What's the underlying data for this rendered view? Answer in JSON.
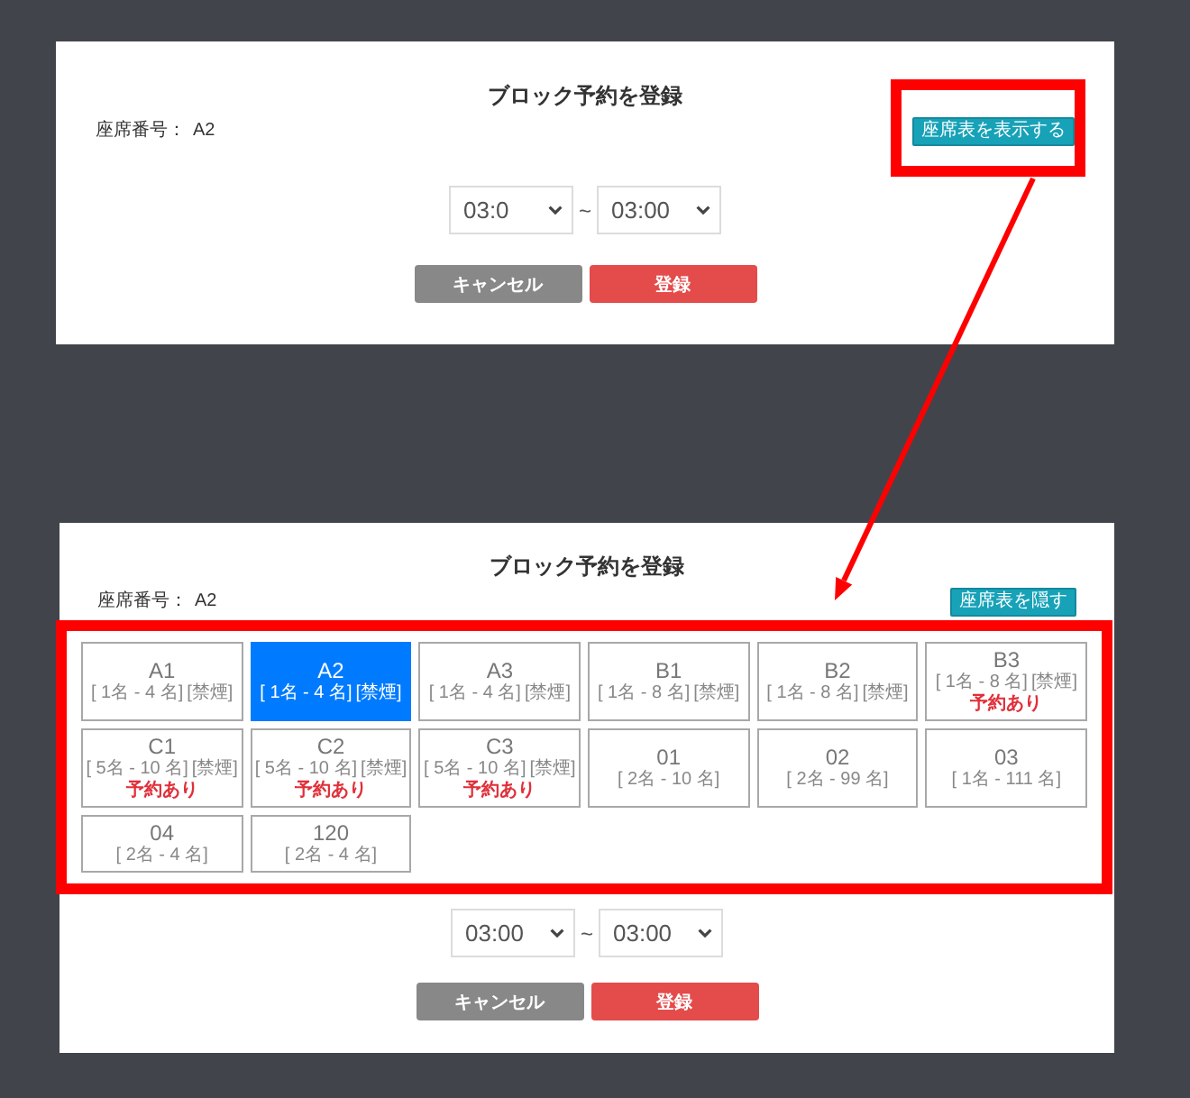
{
  "panels": [
    {
      "title": "ブロック予約を登録",
      "seat_label": "座席番号：",
      "seat_value": "A2",
      "toggle_button": {
        "label": "座席表を表示する",
        "highlighted": true
      },
      "time_from": "03:0",
      "time_separator": "~",
      "time_to": "03:00",
      "buttons": [
        {
          "label": "キャンセル",
          "kind": "cancel"
        },
        {
          "label": "登録",
          "kind": "submit"
        }
      ]
    },
    {
      "title": "ブロック予約を登録",
      "seat_label": "座席番号：",
      "seat_value": "A2",
      "toggle_button": {
        "label": "座席表を隠す"
      },
      "seat_map": {
        "highlighted": true,
        "seats": [
          {
            "name": "A1",
            "capacity": "[ 1名 - 4 名]",
            "smoking": "[禁煙]",
            "selected": false
          },
          {
            "name": "A2",
            "capacity": "[ 1名 - 4 名]",
            "smoking": "[禁煙]",
            "selected": true
          },
          {
            "name": "A3",
            "capacity": "[ 1名 - 4 名]",
            "smoking": "[禁煙]",
            "selected": false
          },
          {
            "name": "B1",
            "capacity": "[ 1名 - 8 名]",
            "smoking": "[禁煙]",
            "selected": false
          },
          {
            "name": "B2",
            "capacity": "[ 1名 - 8 名]",
            "smoking": "[禁煙]",
            "selected": false
          },
          {
            "name": "B3",
            "capacity": "[ 1名 - 8 名]",
            "smoking": "[禁煙]",
            "status": "予約あり",
            "selected": false
          },
          {
            "name": "C1",
            "capacity": "[ 5名 - 10 名]",
            "smoking": "[禁煙]",
            "status": "予約あり",
            "selected": false
          },
          {
            "name": "C2",
            "capacity": "[ 5名 - 10 名]",
            "smoking": "[禁煙]",
            "status": "予約あり",
            "selected": false
          },
          {
            "name": "C3",
            "capacity": "[ 5名 - 10 名]",
            "smoking": "[禁煙]",
            "status": "予約あり",
            "selected": false
          },
          {
            "name": "01",
            "capacity": "[ 2名 - 10 名]",
            "selected": false
          },
          {
            "name": "02",
            "capacity": "[ 2名 - 99 名]",
            "selected": false
          },
          {
            "name": "03",
            "capacity": "[ 1名 - 111 名]",
            "selected": false
          },
          {
            "name": "04",
            "capacity": "[ 2名 - 4 名]",
            "selected": false
          },
          {
            "name": "120",
            "capacity": "[ 2名 - 4 名]",
            "selected": false
          }
        ]
      },
      "time_from": "03:00",
      "time_separator": "~",
      "time_to": "03:00",
      "buttons": [
        {
          "label": "キャンセル",
          "kind": "cancel"
        },
        {
          "label": "登録",
          "kind": "submit"
        }
      ]
    }
  ]
}
